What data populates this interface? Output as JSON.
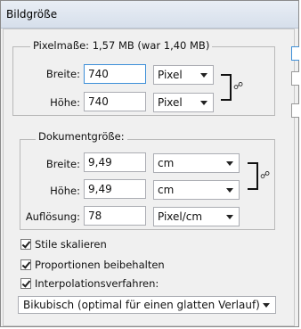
{
  "window": {
    "title": "Bildgröße"
  },
  "pixel_dimensions": {
    "legend": "Pixelmaße: 1,57 MB (war 1,40 MB)",
    "width_label": "Breite:",
    "width_value": "740",
    "width_unit": "Pixel",
    "height_label": "Höhe:",
    "height_value": "740",
    "height_unit": "Pixel"
  },
  "document_size": {
    "legend": "Dokumentgröße:",
    "width_label": "Breite:",
    "width_value": "9,49",
    "width_unit": "cm",
    "height_label": "Höhe:",
    "height_value": "9,49",
    "height_unit": "cm",
    "resolution_label": "Auflösung:",
    "resolution_value": "78",
    "resolution_unit": "Pixel/cm"
  },
  "options": {
    "scale_styles": "Stile skalieren",
    "constrain_proportions": "Proportionen beibehalten",
    "resample_image": "Interpolationsverfahren:",
    "resample_method": "Bikubisch (optimal für einen glatten Verlauf)"
  }
}
